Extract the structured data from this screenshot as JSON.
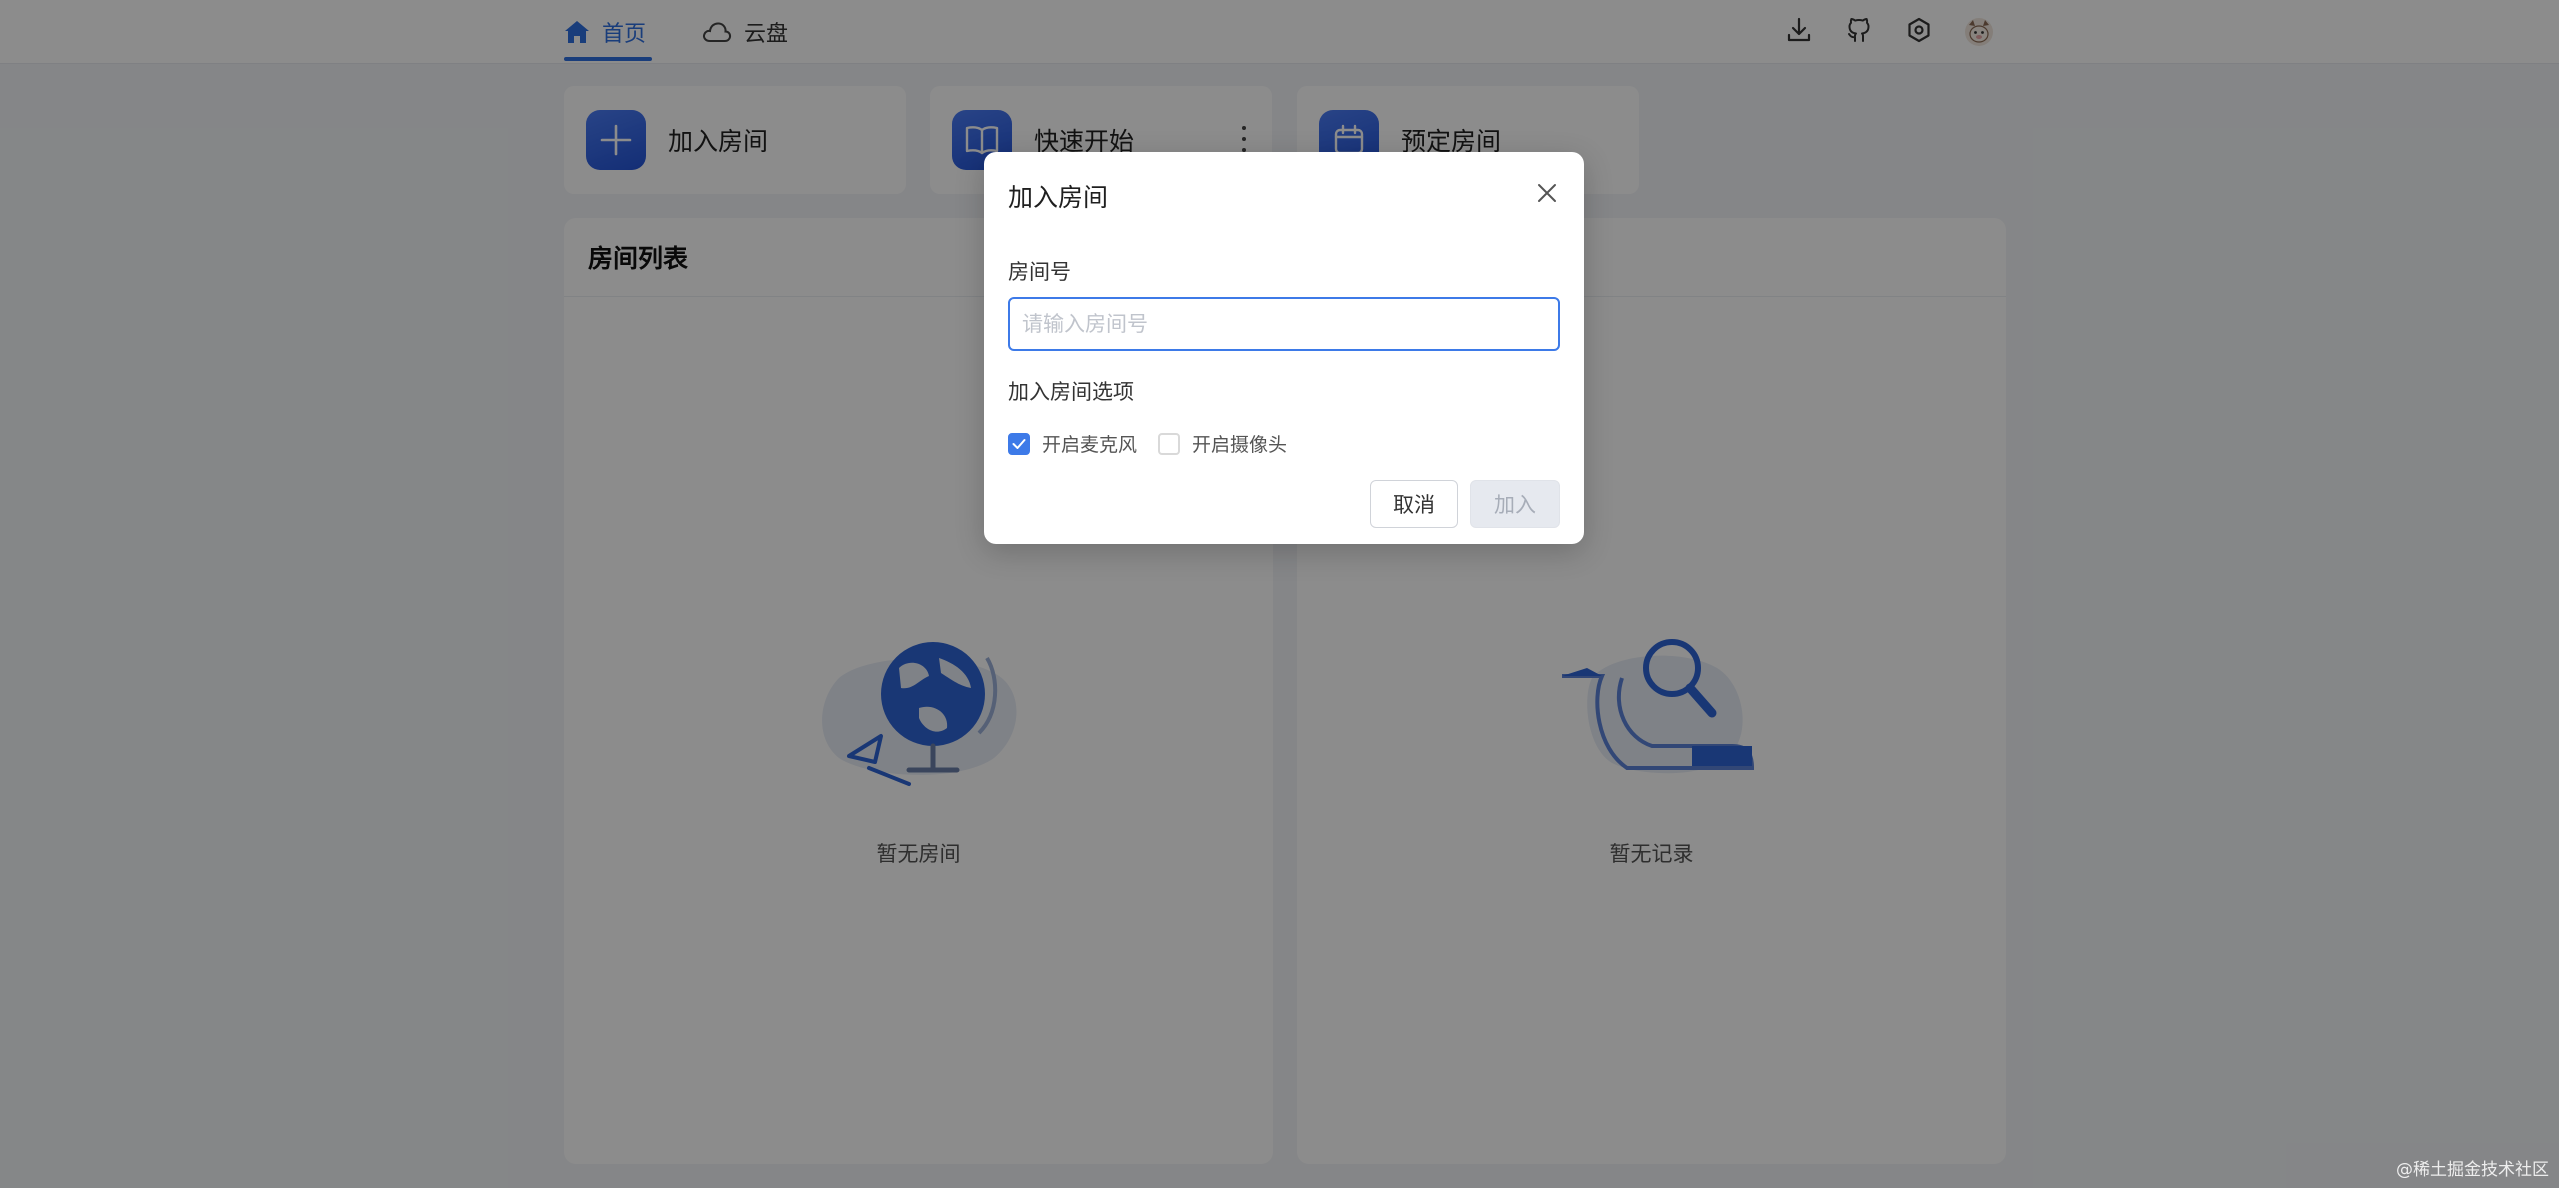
{
  "nav": {
    "tabs": [
      {
        "label": "首页",
        "icon": "home-icon",
        "active": true
      },
      {
        "label": "云盘",
        "icon": "cloud-icon",
        "active": false
      }
    ],
    "actions": [
      "download-icon",
      "github-icon",
      "settings-icon",
      "avatar"
    ]
  },
  "quick_actions": [
    {
      "label": "加入房间",
      "icon": "plus-icon"
    },
    {
      "label": "快速开始",
      "icon": "book-icon"
    },
    {
      "label": "预定房间",
      "icon": "calendar-icon"
    }
  ],
  "room_list": {
    "title": "房间列表",
    "empty_text": "暂无房间"
  },
  "history": {
    "empty_text": "暂无记录"
  },
  "modal": {
    "title": "加入房间",
    "room_number_label": "房间号",
    "room_number_placeholder": "请输入房间号",
    "room_number_value": "",
    "options_label": "加入房间选项",
    "options": [
      {
        "label": "开启麦克风",
        "checked": true
      },
      {
        "label": "开启摄像头",
        "checked": false
      }
    ],
    "cancel_label": "取消",
    "join_label": "加入"
  },
  "colors": {
    "accent": "#2e6fe0",
    "mask": "rgba(0,0,0,0.45)"
  },
  "watermark": "@稀土掘金技术社区"
}
